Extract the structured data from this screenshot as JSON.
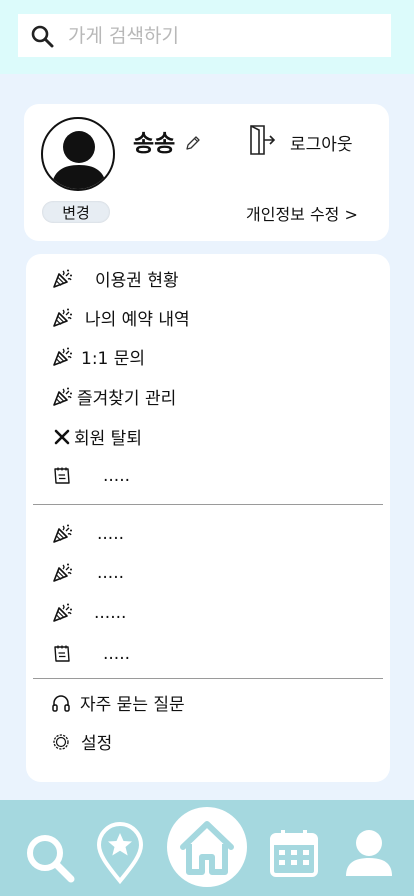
{
  "search": {
    "placeholder": "가게 검색하기",
    "icon": "search-icon"
  },
  "profile": {
    "name": "송송",
    "edit_name_icon": "pencil-icon",
    "logout_label": "로그아웃",
    "change_label": "변경",
    "edit_info_label": "개인정보 수정 >"
  },
  "menu": {
    "group1": [
      {
        "icon": "party-popper-icon",
        "label": "이용권 현황"
      },
      {
        "icon": "party-popper-icon",
        "label": "나의 예약 내역"
      },
      {
        "icon": "party-popper-icon",
        "label": "1:1 문의"
      },
      {
        "icon": "party-popper-icon",
        "label": "즐겨찾기 관리"
      },
      {
        "icon": "close-icon",
        "label": "회원 탈퇴"
      },
      {
        "icon": "notepad-icon",
        "label": "....."
      }
    ],
    "group2": [
      {
        "icon": "party-popper-icon",
        "label": "....."
      },
      {
        "icon": "party-popper-icon",
        "label": "....."
      },
      {
        "icon": "party-popper-icon",
        "label": "......"
      },
      {
        "icon": "notepad-icon",
        "label": "....."
      }
    ],
    "group3": [
      {
        "icon": "headphones-icon",
        "label": "자주 묻는 질문"
      },
      {
        "icon": "gear-icon",
        "label": "설정"
      }
    ]
  },
  "bottom_nav": [
    "search-icon",
    "map-pin-star-icon",
    "home-icon",
    "calendar-icon",
    "user-icon"
  ],
  "colors": {
    "top_bar": "#dcfbfb",
    "background": "#eaf3fd",
    "bottom_nav": "#a5d8df",
    "nav_icon": "#ffffff"
  }
}
